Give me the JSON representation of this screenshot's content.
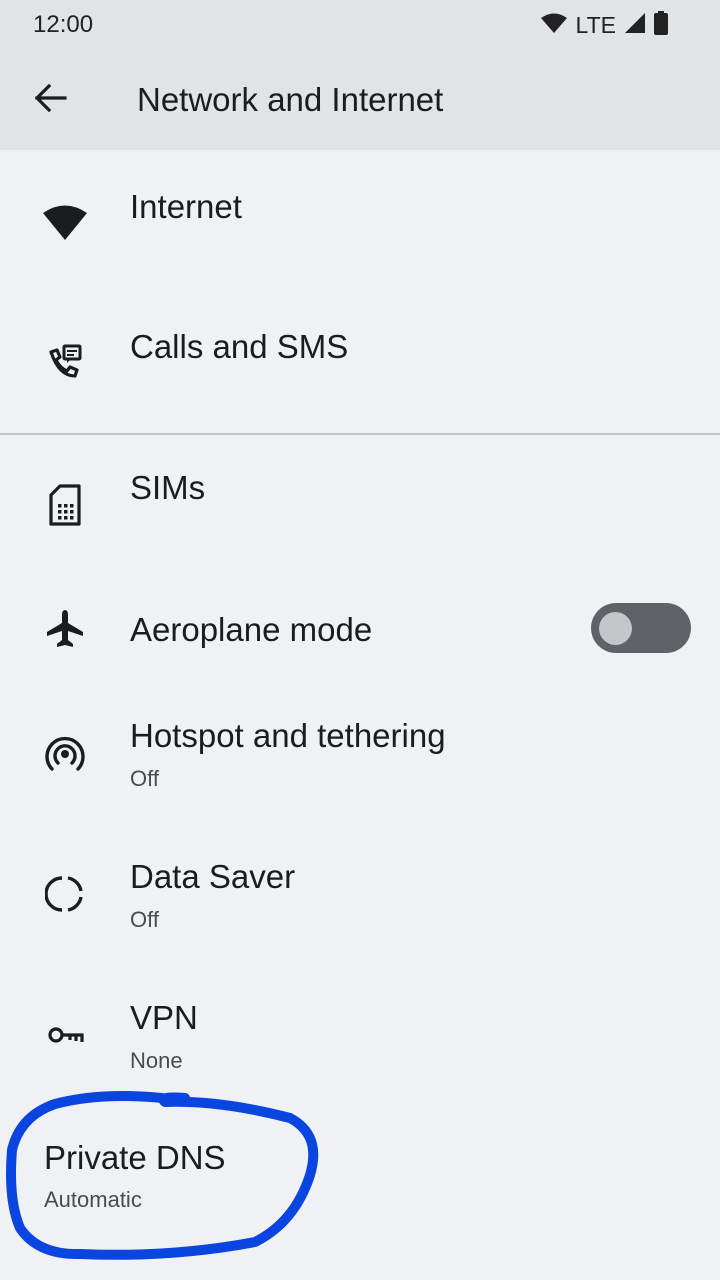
{
  "status_bar": {
    "time": "12:00",
    "network": "LTE"
  },
  "app_bar": {
    "title": "Network and Internet"
  },
  "items": [
    {
      "key": "internet",
      "title": "Internet",
      "icon": "wifi-icon"
    },
    {
      "key": "calls",
      "title": "Calls and SMS",
      "icon": "calls-sms-icon"
    },
    {
      "key": "sims",
      "title": "SIMs",
      "icon": "sim-card-icon"
    },
    {
      "key": "aeroplane",
      "title": "Aeroplane mode",
      "icon": "airplane-icon",
      "toggle_on": false
    },
    {
      "key": "hotspot",
      "title": "Hotspot and tethering",
      "summary": "Off",
      "icon": "hotspot-icon"
    },
    {
      "key": "datasaver",
      "title": "Data Saver",
      "summary": "Off",
      "icon": "data-saver-icon"
    },
    {
      "key": "vpn",
      "title": "VPN",
      "summary": "None",
      "icon": "vpn-key-icon"
    },
    {
      "key": "privatedns",
      "title": "Private DNS",
      "summary": "Automatic"
    }
  ],
  "annotation": {
    "color": "#0a45e0"
  },
  "colors": {
    "background": "#eff1f4",
    "app_bar": "#e1e4e6",
    "toggle_track_off": "#5f6266",
    "toggle_thumb_off": "#c4c6c9"
  }
}
